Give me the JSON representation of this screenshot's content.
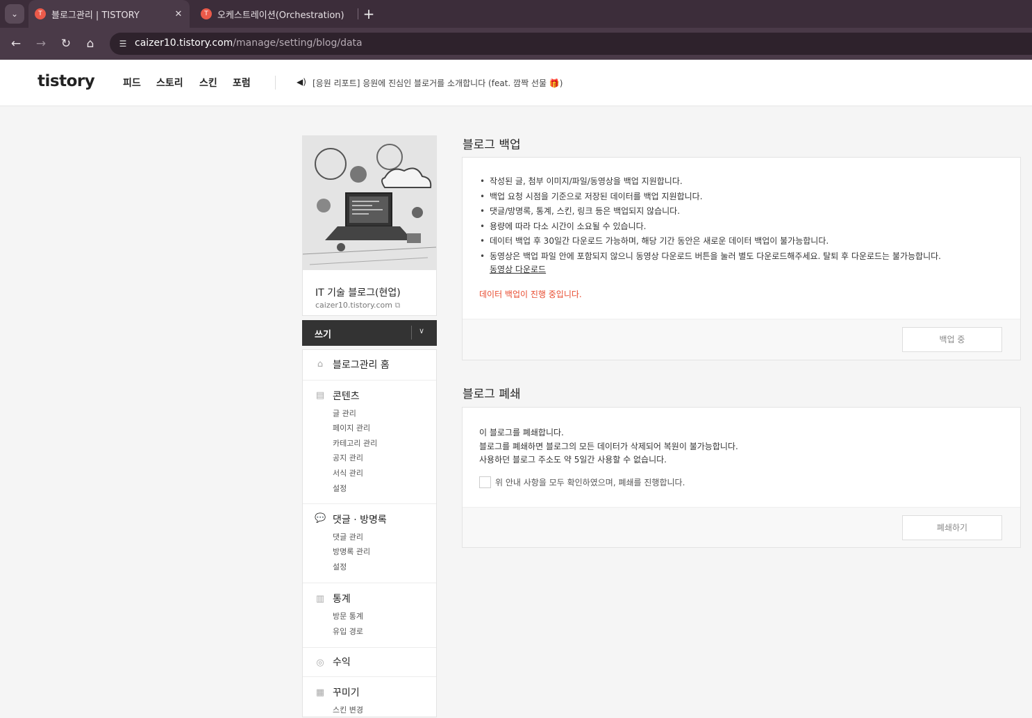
{
  "browser": {
    "tabs": [
      {
        "title": "블로그관리 | TISTORY",
        "active": true
      },
      {
        "title": "오케스트레이션(Orchestration)",
        "active": false
      }
    ],
    "url_host": "caizer10.tistory.com",
    "url_path": "/manage/setting/blog/data"
  },
  "topnav": {
    "logo": "tistory",
    "items": [
      "피드",
      "스토리",
      "스킨",
      "포럼"
    ],
    "notice": "[응원 리포트] 응원에 진심인 블로거를 소개합니다 (feat. 깜짝 선물 🎁)"
  },
  "sidebar": {
    "blog_title": "IT 기술 블로그(현업)",
    "blog_url": "caizer10.tistory.com",
    "write_label": "쓰기",
    "home": "블로그관리 홈",
    "sections": [
      {
        "title": "콘텐츠",
        "icon": "document-icon",
        "items": [
          "글 관리",
          "페이지 관리",
          "카테고리 관리",
          "공지 관리",
          "서식 관리",
          "설정"
        ]
      },
      {
        "title": "댓글 · 방명록",
        "icon": "comment-icon",
        "items": [
          "댓글 관리",
          "방명록 관리",
          "설정"
        ]
      },
      {
        "title": "통계",
        "icon": "chart-icon",
        "items": [
          "방문 통계",
          "유입 경로"
        ]
      },
      {
        "title": "수익",
        "icon": "coin-icon",
        "items": []
      },
      {
        "title": "꾸미기",
        "icon": "layout-icon",
        "items": [
          "스킨 변경"
        ]
      }
    ]
  },
  "backup": {
    "title": "블로그 백업",
    "bullets": [
      "작성된 글, 첨부 이미지/파일/동영상을 백업 지원합니다.",
      "백업 요청 시점을 기준으로 저장된 데이터를 백업 지원합니다.",
      "댓글/방명록, 통계, 스킨, 링크 등은 백업되지 않습니다.",
      "용량에 따라 다소 시간이 소요될 수 있습니다.",
      "데이터 백업 후 30일간 다운로드 가능하며, 해당 기간 동안은 새로운 데이터 백업이 불가능합니다.",
      "동영상은 백업 파일 안에 포함되지 않으니 동영상 다운로드 버튼을 눌러 별도 다운로드해주세요. 탈퇴 후 다운로드는 불가능합니다."
    ],
    "video_link": "동영상 다운로드",
    "status": "데이터 백업이 진행 중입니다.",
    "button": "백업 중"
  },
  "closure": {
    "title": "블로그 폐쇄",
    "lines": [
      "이 블로그를 폐쇄합니다.",
      "블로그를 폐쇄하면 블로그의 모든 데이터가 삭제되어 복원이 불가능합니다.",
      "사용하던 블로그 주소도 약 5일간 사용할 수 없습니다."
    ],
    "agree": "위 안내 사항을 모두 확인하였으며, 폐쇄를 진행합니다.",
    "button": "폐쇄하기"
  },
  "colors": {
    "accent_red": "#e84b2f",
    "browser_frame": "#3c2d3a"
  }
}
